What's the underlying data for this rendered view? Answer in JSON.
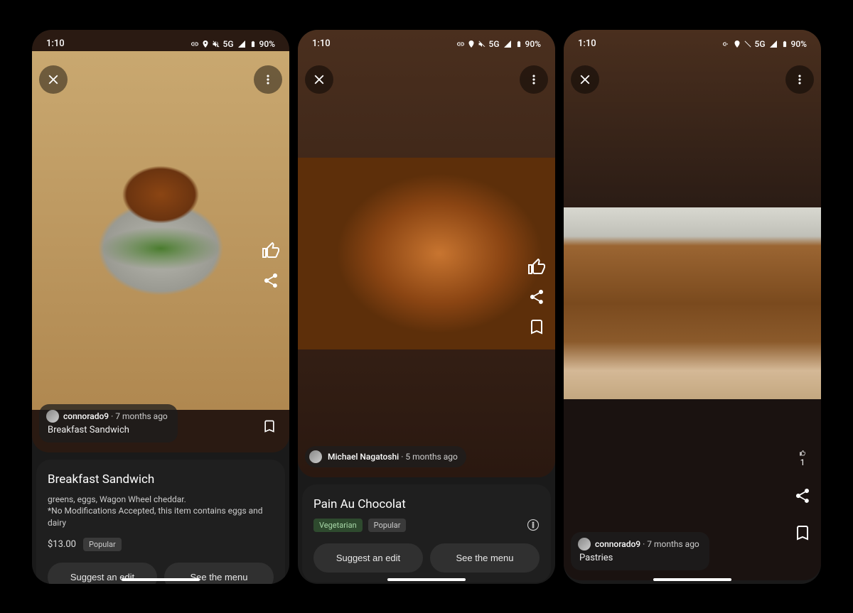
{
  "status": {
    "time": "1:10",
    "network": "5G",
    "battery": "90%"
  },
  "screens": [
    {
      "author": {
        "name": "connorado9",
        "time": "7 months ago"
      },
      "caption": "Breakfast Sandwich",
      "detail": {
        "title": "Breakfast Sandwich",
        "desc_line1": "greens, eggs, Wagon Wheel cheddar.",
        "desc_line2": "*No Modifications Accepted, this item contains eggs and dairy",
        "price": "$13.00",
        "tags": [
          "Popular"
        ],
        "btn_suggest": "Suggest an edit",
        "btn_menu": "See the menu"
      }
    },
    {
      "author": {
        "name": "Michael Nagatoshi",
        "time": "5 months ago"
      },
      "detail": {
        "title": "Pain Au Chocolat",
        "tags": [
          "Vegetarian",
          "Popular"
        ],
        "btn_suggest": "Suggest an edit",
        "btn_menu": "See the menu"
      }
    },
    {
      "author": {
        "name": "connorado9",
        "time": "7 months ago"
      },
      "caption": "Pastries",
      "like_count": "1"
    }
  ]
}
